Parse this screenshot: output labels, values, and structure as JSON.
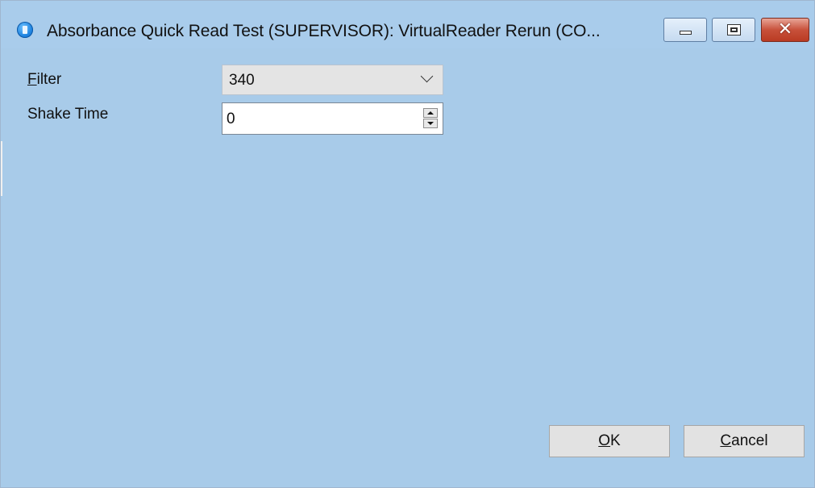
{
  "window": {
    "title": "Absorbance Quick Read Test (SUPERVISOR): VirtualReader Rerun (CO...",
    "icon": "app-icon",
    "background_color": "#a8cbe9"
  },
  "caption_buttons": {
    "minimize_icon": "minimize-icon",
    "maximize_icon": "restore-icon",
    "close_glyph": "✕"
  },
  "form": {
    "filter": {
      "label_underlined": "F",
      "label_rest": "ilter",
      "value": "340"
    },
    "shake_time": {
      "label": "Shake Time",
      "value": "0"
    }
  },
  "buttons": {
    "ok": {
      "underlined": "O",
      "rest": "K"
    },
    "cancel": {
      "underlined": "C",
      "rest": "ancel"
    }
  }
}
